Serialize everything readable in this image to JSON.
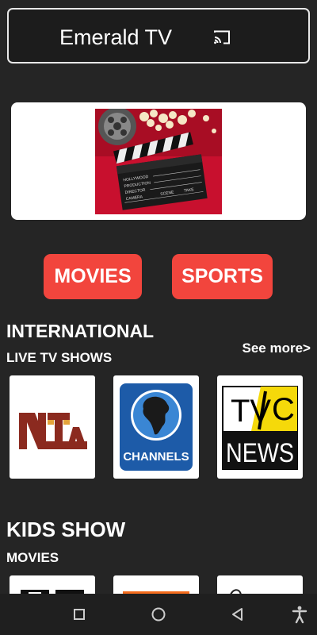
{
  "app": {
    "title": "Emerald TV",
    "accent_color": "#f2453d",
    "cast_icon": "cast-icon"
  },
  "banner": {
    "image": "movie-clapperboard-popcorn-image",
    "clapper_lines": [
      "HOLLYWOOD",
      "PRODUCTION",
      "DIRECTOR",
      "CAMERA",
      "SCENE",
      "TAKE"
    ]
  },
  "categories": [
    {
      "label": "MOVIES"
    },
    {
      "label": "SPORTS"
    }
  ],
  "international": {
    "title": "INTERNATIONAL",
    "subtitle": "LIVE TV SHOWS",
    "see_more": "See more>",
    "channels": [
      {
        "name": "NTA",
        "logo_text": "NTA"
      },
      {
        "name": "Channels",
        "logo_text": "CHANNELS"
      },
      {
        "name": "TVC News",
        "logo_text_top": "TV",
        "logo_text_c": "C",
        "logo_text_bottom": "NEWS"
      }
    ]
  },
  "kids": {
    "title": "KIDS SHOW",
    "subtitle": "MOVIES"
  },
  "system_nav": [
    "recents-icon",
    "home-icon",
    "back-icon",
    "accessibility-icon"
  ]
}
